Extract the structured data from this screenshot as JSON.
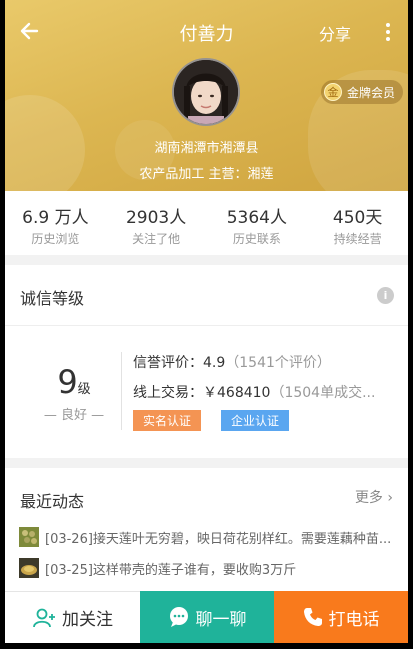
{
  "header": {
    "title": "付善力",
    "share_label": "分享",
    "badge_text": "金牌会员",
    "badge_coin": "金",
    "location": "湖南湘潭市湘潭县",
    "business": "农产品加工  主营：湘莲"
  },
  "stats": [
    {
      "value": "6.9 万人",
      "label": "历史浏览"
    },
    {
      "value": "2903人",
      "label": "关注了他"
    },
    {
      "value": "5364人",
      "label": "历史联系"
    },
    {
      "value": "450天",
      "label": "持续经营"
    }
  ],
  "credit": {
    "title": "诚信等级",
    "level": "9",
    "level_unit": "级",
    "level_text": "良好",
    "rating_label": "信誉评价：4.9",
    "rating_count": "（1541个评价）",
    "trade_label": "线上交易：￥468410",
    "trade_count": "（1504单成交...",
    "tag_realname": "实名认证",
    "tag_company": "企业认证"
  },
  "recent": {
    "title": "最近动态",
    "more_label": "更多",
    "items": [
      {
        "text": "[03-26]接天莲叶无穷碧，映日荷花别样红。需要莲藕种苗..."
      },
      {
        "text": "[03-25]这样带壳的莲子谁有，要收购3万斤"
      }
    ]
  },
  "bottom": {
    "follow_label": "加关注",
    "chat_label": "聊一聊",
    "call_label": "打电话"
  },
  "colors": {
    "gold": "#dcb651",
    "chat": "#1fb39a",
    "call": "#f97a1c",
    "tag_realname": "#f49453",
    "tag_company": "#5aa6f0"
  }
}
